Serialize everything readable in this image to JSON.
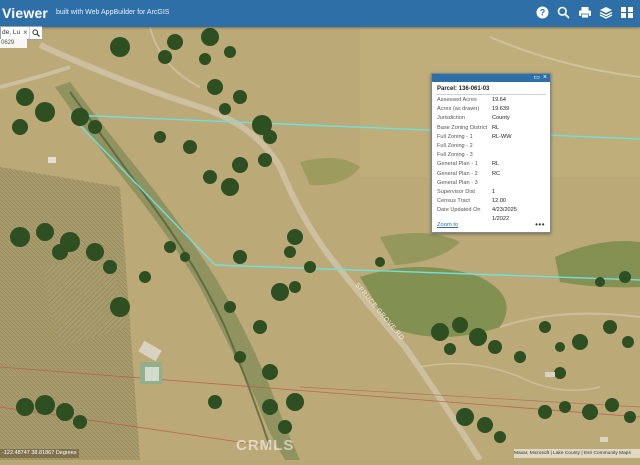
{
  "header": {
    "title": "Viewer",
    "subtitle": "built with Web AppBuilder for ArcGIS",
    "icons": [
      "help-icon",
      "search-icon",
      "print-icon",
      "layers-icon",
      "basemap-gallery-icon"
    ]
  },
  "search": {
    "value": "de, Lu",
    "clear_glyph": "×",
    "result_text": "0629"
  },
  "map": {
    "road_label": "SPRUCE GROVE RD",
    "parcel_line_color": "#6fe0dc",
    "road_color": "#c4b69a",
    "terrain_color": "#b9a875",
    "vegetation_color": "#2d4f22"
  },
  "popup": {
    "title": "Parcel: 136-061-03",
    "rows": [
      {
        "label": "Assessed Acres",
        "value": "19.64"
      },
      {
        "label": "Acres (as drawn)",
        "value": "19.639"
      },
      {
        "label": "Jurisdiction",
        "value": "County"
      },
      {
        "label": "Base Zoning District",
        "value": "RL"
      },
      {
        "label": "Full Zoning - 1",
        "value": "RL-WW"
      },
      {
        "label": "Full Zoning - 2",
        "value": ""
      },
      {
        "label": "Full Zoning - 3",
        "value": ""
      },
      {
        "label": "General Plan - 1",
        "value": "RL"
      },
      {
        "label": "General Plan - 2",
        "value": "RC"
      },
      {
        "label": "General Plan - 3",
        "value": ""
      },
      {
        "label": "Supervisor Dist",
        "value": "1"
      },
      {
        "label": "Census Tract",
        "value": "12.00"
      },
      {
        "label": "Date Updated On",
        "value": "4/23/2025"
      },
      {
        "label": "",
        "value": "1/2022"
      }
    ],
    "zoom_label": "Zoom to",
    "more_label": "•••",
    "maximize_glyph": "▭",
    "close_glyph": "×"
  },
  "status": {
    "coordinates": "-122.48747 38.81867 Degrees",
    "watermark": "CRMLS",
    "attribution": "Maxar, Microsoft | Lake County | Esri Community Maps"
  }
}
